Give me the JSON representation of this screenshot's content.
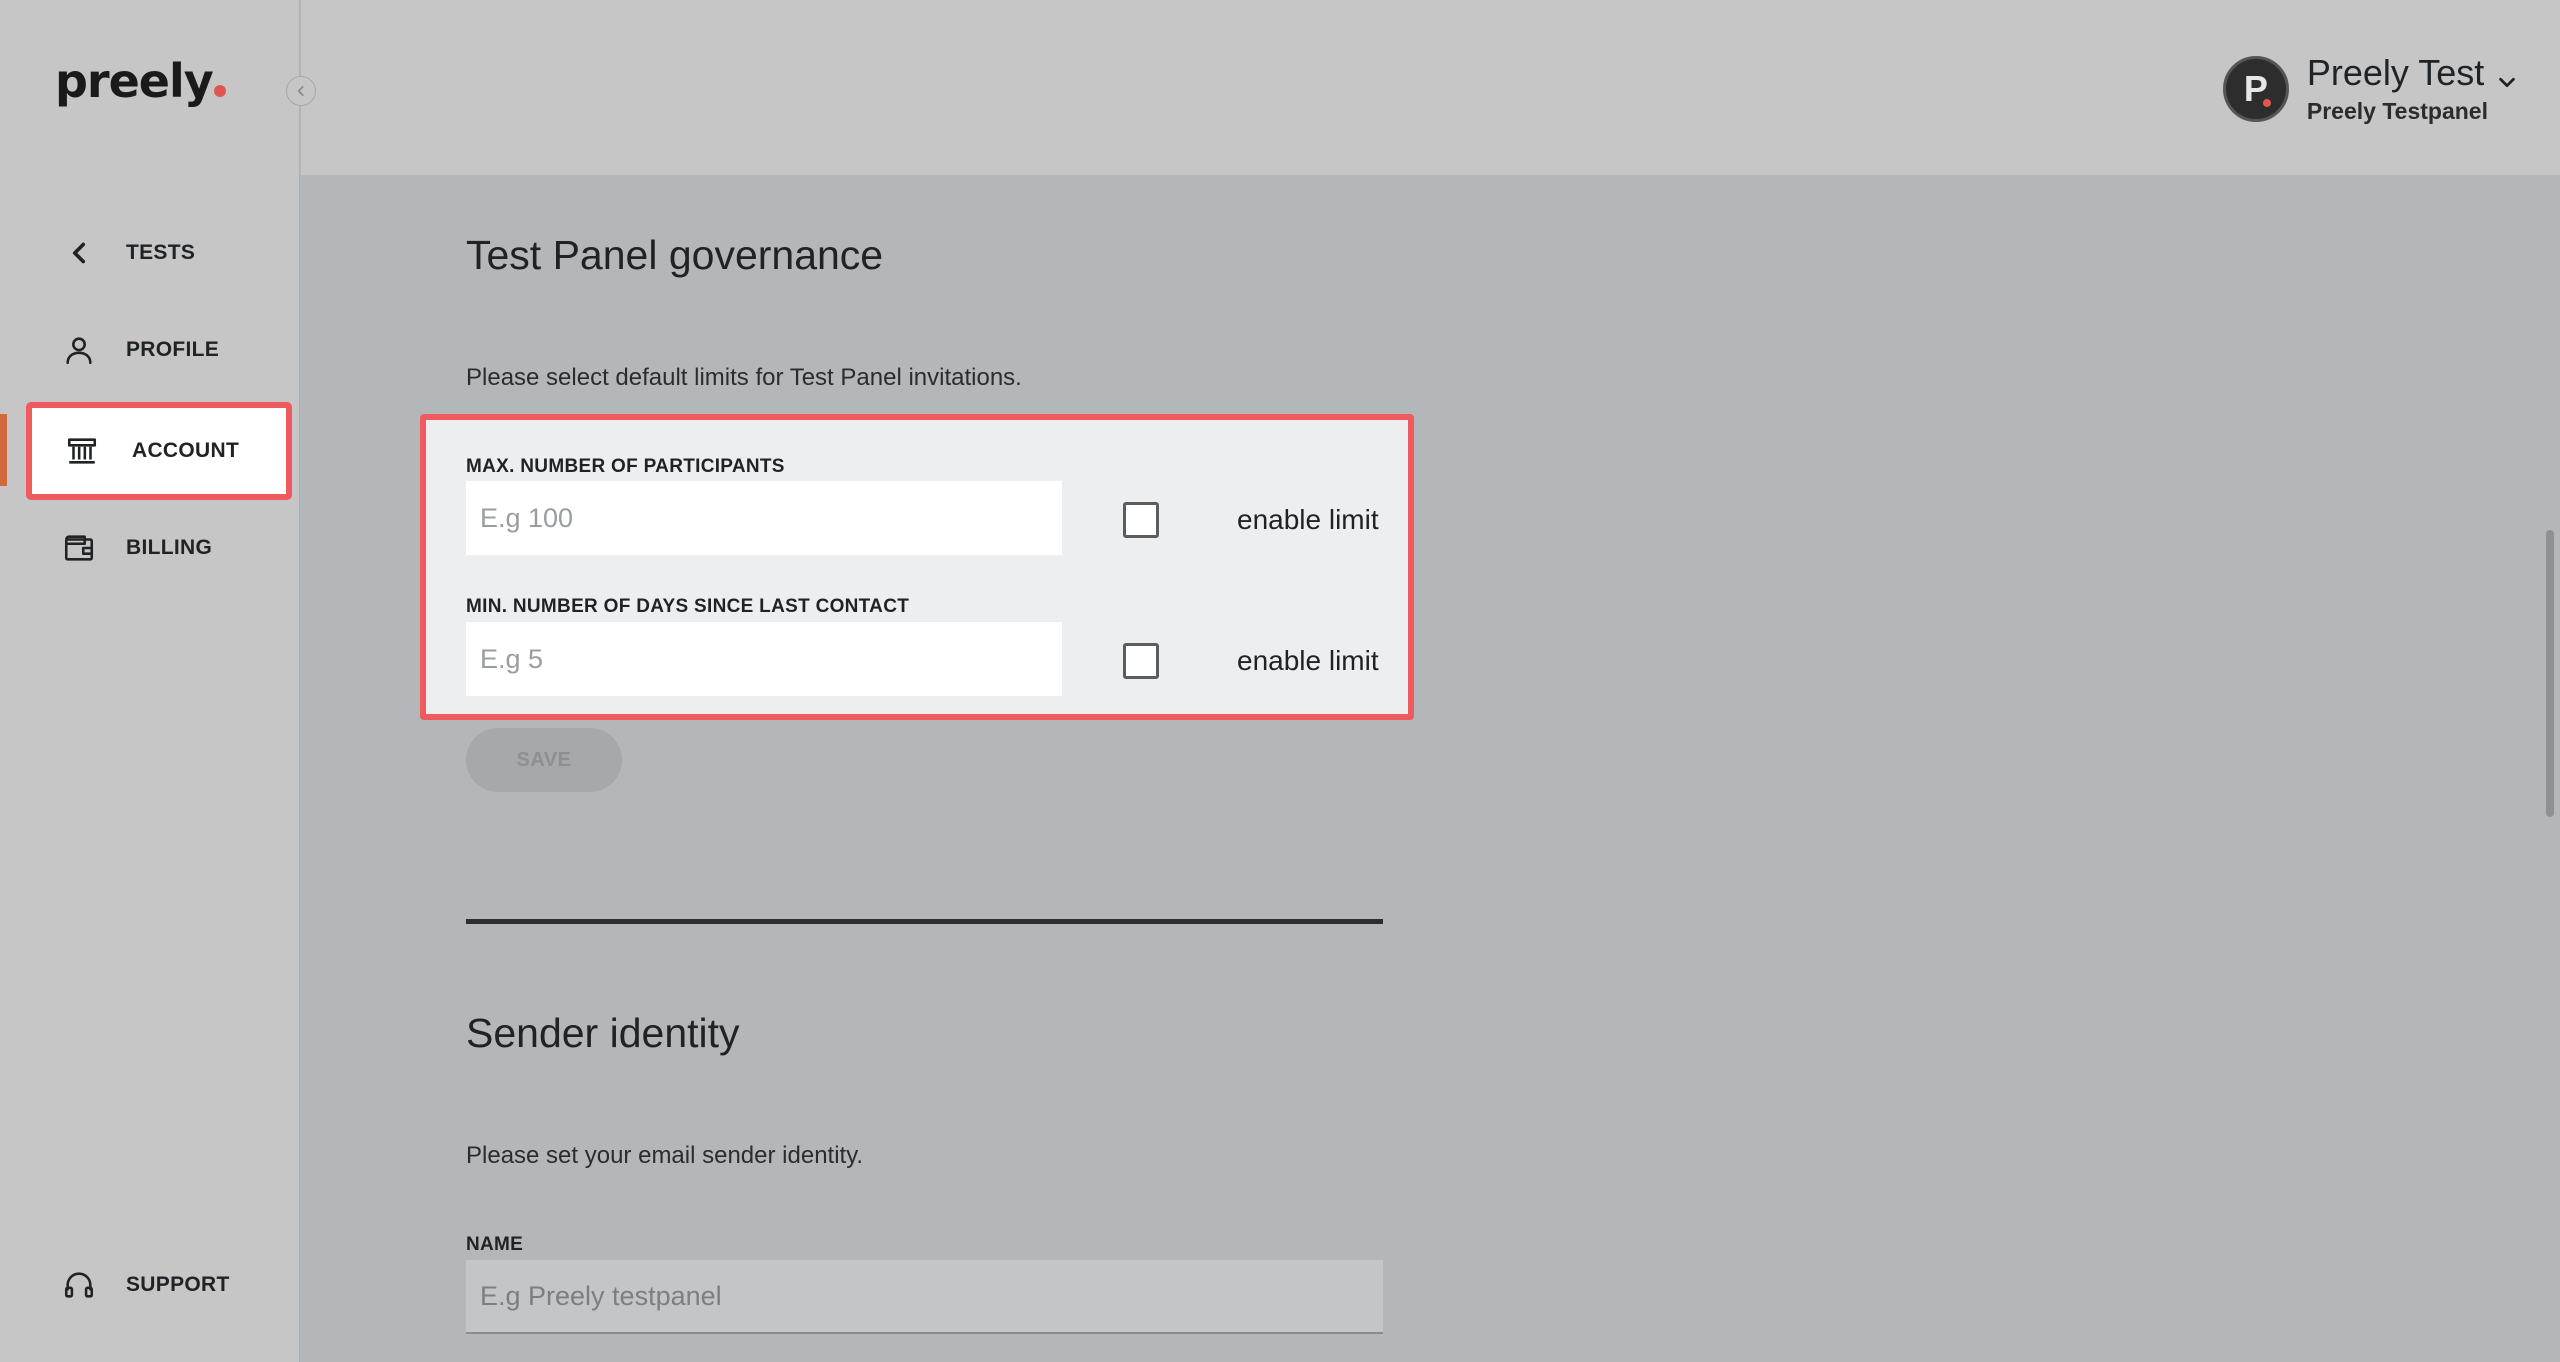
{
  "app": {
    "logo_text": "preely"
  },
  "sidebar": {
    "items": [
      {
        "label": "TESTS",
        "icon": "chevron-left-icon"
      },
      {
        "label": "PROFILE",
        "icon": "user-icon"
      },
      {
        "label": "ACCOUNT",
        "icon": "bank-icon",
        "active": true
      },
      {
        "label": "BILLING",
        "icon": "wallet-icon"
      }
    ],
    "support": {
      "label": "SUPPORT",
      "icon": "headset-icon"
    }
  },
  "header": {
    "user_name": "Preely Test",
    "user_org": "Preely Testpanel",
    "avatar_letter": "P"
  },
  "governance": {
    "title": "Test Panel governance",
    "description": "Please select default limits for Test Panel invitations.",
    "max_participants": {
      "label": "MAX. NUMBER OF PARTICIPANTS",
      "placeholder": "E.g 100",
      "checkbox_label": "enable limit",
      "checked": false
    },
    "min_days": {
      "label": "MIN. NUMBER OF DAYS SINCE LAST CONTACT",
      "placeholder": "E.g 5",
      "checkbox_label": "enable limit",
      "checked": false
    },
    "save_label": "SAVE"
  },
  "sender": {
    "title": "Sender identity",
    "description": "Please set your email sender identity.",
    "name_label": "NAME",
    "name_placeholder": "E.g Preely testpanel"
  },
  "colors": {
    "highlight": "#ef5a5f",
    "accent": "#e0574f",
    "active_bar": "#d06a3c"
  }
}
